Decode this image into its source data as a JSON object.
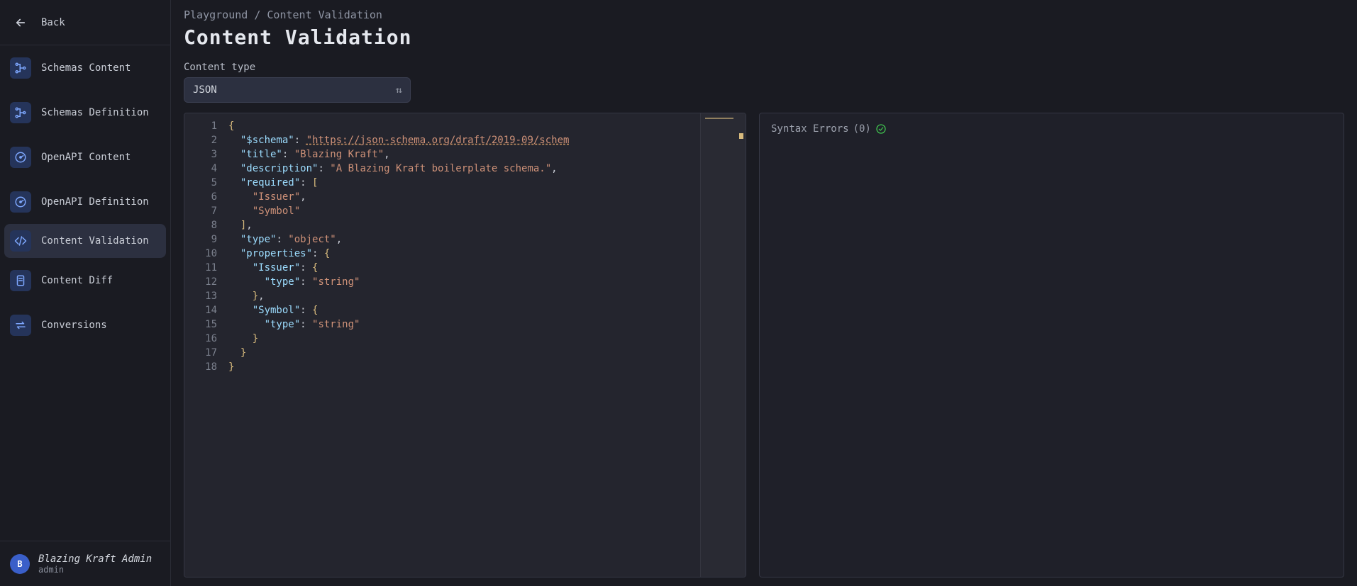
{
  "sidebar": {
    "back_label": "Back",
    "items": [
      {
        "label": "Schemas Content",
        "icon": "schema"
      },
      {
        "label": "Schemas Definition",
        "icon": "schema"
      },
      {
        "label": "OpenAPI Content",
        "icon": "gauge"
      },
      {
        "label": "OpenAPI Definition",
        "icon": "gauge"
      },
      {
        "label": "Content Validation",
        "icon": "code"
      },
      {
        "label": "Content Diff",
        "icon": "diff"
      },
      {
        "label": "Conversions",
        "icon": "swap"
      }
    ]
  },
  "user": {
    "avatar_initial": "B",
    "name": "Blazing Kraft Admin",
    "role": "admin"
  },
  "breadcrumb": "Playground / Content Validation",
  "page_title": "Content Validation",
  "content_type": {
    "label": "Content type",
    "value": "JSON"
  },
  "editor": {
    "lines": [
      [
        {
          "t": "brace",
          "v": "{"
        }
      ],
      [
        {
          "t": "sp",
          "v": "  "
        },
        {
          "t": "key",
          "v": "\"$schema\""
        },
        {
          "t": "colon",
          "v": ": "
        },
        {
          "t": "url",
          "v": "\"https://json-schema.org/draft/2019-09/schem"
        }
      ],
      [
        {
          "t": "sp",
          "v": "  "
        },
        {
          "t": "key",
          "v": "\"title\""
        },
        {
          "t": "colon",
          "v": ": "
        },
        {
          "t": "str",
          "v": "\"Blazing Kraft\""
        },
        {
          "t": "punc",
          "v": ","
        }
      ],
      [
        {
          "t": "sp",
          "v": "  "
        },
        {
          "t": "key",
          "v": "\"description\""
        },
        {
          "t": "colon",
          "v": ": "
        },
        {
          "t": "str",
          "v": "\"A Blazing Kraft boilerplate schema.\""
        },
        {
          "t": "punc",
          "v": ","
        }
      ],
      [
        {
          "t": "sp",
          "v": "  "
        },
        {
          "t": "key",
          "v": "\"required\""
        },
        {
          "t": "colon",
          "v": ": "
        },
        {
          "t": "brace",
          "v": "["
        }
      ],
      [
        {
          "t": "sp",
          "v": "    "
        },
        {
          "t": "str",
          "v": "\"Issuer\""
        },
        {
          "t": "punc",
          "v": ","
        }
      ],
      [
        {
          "t": "sp",
          "v": "    "
        },
        {
          "t": "str",
          "v": "\"Symbol\""
        }
      ],
      [
        {
          "t": "sp",
          "v": "  "
        },
        {
          "t": "brace",
          "v": "]"
        },
        {
          "t": "punc",
          "v": ","
        }
      ],
      [
        {
          "t": "sp",
          "v": "  "
        },
        {
          "t": "key",
          "v": "\"type\""
        },
        {
          "t": "colon",
          "v": ": "
        },
        {
          "t": "str",
          "v": "\"object\""
        },
        {
          "t": "punc",
          "v": ","
        }
      ],
      [
        {
          "t": "sp",
          "v": "  "
        },
        {
          "t": "key",
          "v": "\"properties\""
        },
        {
          "t": "colon",
          "v": ": "
        },
        {
          "t": "brace",
          "v": "{"
        }
      ],
      [
        {
          "t": "sp",
          "v": "    "
        },
        {
          "t": "key",
          "v": "\"Issuer\""
        },
        {
          "t": "colon",
          "v": ": "
        },
        {
          "t": "brace",
          "v": "{"
        }
      ],
      [
        {
          "t": "sp",
          "v": "      "
        },
        {
          "t": "key",
          "v": "\"type\""
        },
        {
          "t": "colon",
          "v": ": "
        },
        {
          "t": "str",
          "v": "\"string\""
        }
      ],
      [
        {
          "t": "sp",
          "v": "    "
        },
        {
          "t": "brace",
          "v": "}"
        },
        {
          "t": "punc",
          "v": ","
        }
      ],
      [
        {
          "t": "sp",
          "v": "    "
        },
        {
          "t": "key",
          "v": "\"Symbol\""
        },
        {
          "t": "colon",
          "v": ": "
        },
        {
          "t": "brace",
          "v": "{"
        }
      ],
      [
        {
          "t": "sp",
          "v": "      "
        },
        {
          "t": "key",
          "v": "\"type\""
        },
        {
          "t": "colon",
          "v": ": "
        },
        {
          "t": "str",
          "v": "\"string\""
        }
      ],
      [
        {
          "t": "sp",
          "v": "    "
        },
        {
          "t": "brace",
          "v": "}"
        }
      ],
      [
        {
          "t": "sp",
          "v": "  "
        },
        {
          "t": "brace",
          "v": "}"
        }
      ],
      [
        {
          "t": "brace",
          "v": "}"
        }
      ]
    ]
  },
  "errors": {
    "title": "Syntax Errors",
    "count": "(0)"
  }
}
